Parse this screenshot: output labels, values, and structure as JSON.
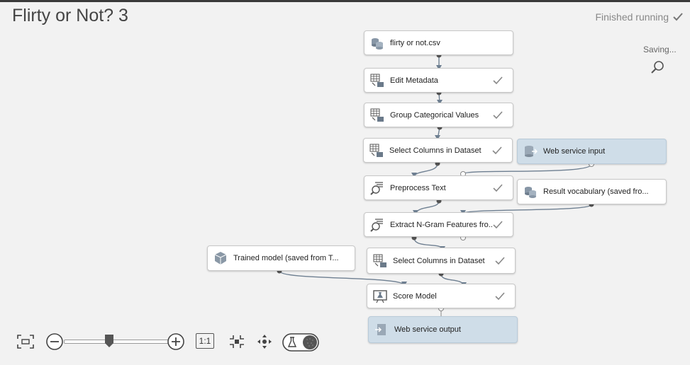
{
  "experiment": {
    "title": "Flirty or Not? 3",
    "status": "Finished running",
    "saving": "Saving..."
  },
  "modules": [
    {
      "label": "flirty or not.csv",
      "icon": "dataset-icon",
      "completed": false,
      "service_io": false
    },
    {
      "label": "Edit Metadata",
      "icon": "grid-transform-icon",
      "completed": true,
      "service_io": false
    },
    {
      "label": "Group Categorical Values",
      "icon": "grid-transform-icon",
      "completed": true,
      "service_io": false
    },
    {
      "label": "Select Columns in Dataset",
      "icon": "grid-transform-icon",
      "completed": true,
      "service_io": false
    },
    {
      "label": "Web service input",
      "icon": "web-service-input-icon",
      "completed": false,
      "service_io": true
    },
    {
      "label": "Preprocess Text",
      "icon": "text-analytics-icon",
      "completed": true,
      "service_io": false
    },
    {
      "label": "Result vocabulary (saved fro...",
      "icon": "dataset-icon",
      "completed": false,
      "service_io": false
    },
    {
      "label": "Extract N-Gram Features fro...",
      "icon": "text-analytics-icon",
      "completed": true,
      "service_io": false
    },
    {
      "label": "Trained model (saved from T...",
      "icon": "trained-model-icon",
      "completed": false,
      "service_io": false
    },
    {
      "label": "Select Columns in Dataset",
      "icon": "grid-transform-icon",
      "completed": true,
      "service_io": false
    },
    {
      "label": "Score Model",
      "icon": "score-model-icon",
      "completed": true,
      "service_io": false
    },
    {
      "label": "Web service output",
      "icon": "web-service-output-icon",
      "completed": false,
      "service_io": true
    }
  ],
  "toolbar": {
    "fit": "fit-to-screen-icon",
    "zoom_out": "zoom-out-icon",
    "zoom_in": "zoom-in-icon",
    "actual_size": "1:1",
    "minimap": "minimap-icon",
    "pan": "pan-icon",
    "experiment_toggle": "experiment-view-toggle-icon"
  }
}
